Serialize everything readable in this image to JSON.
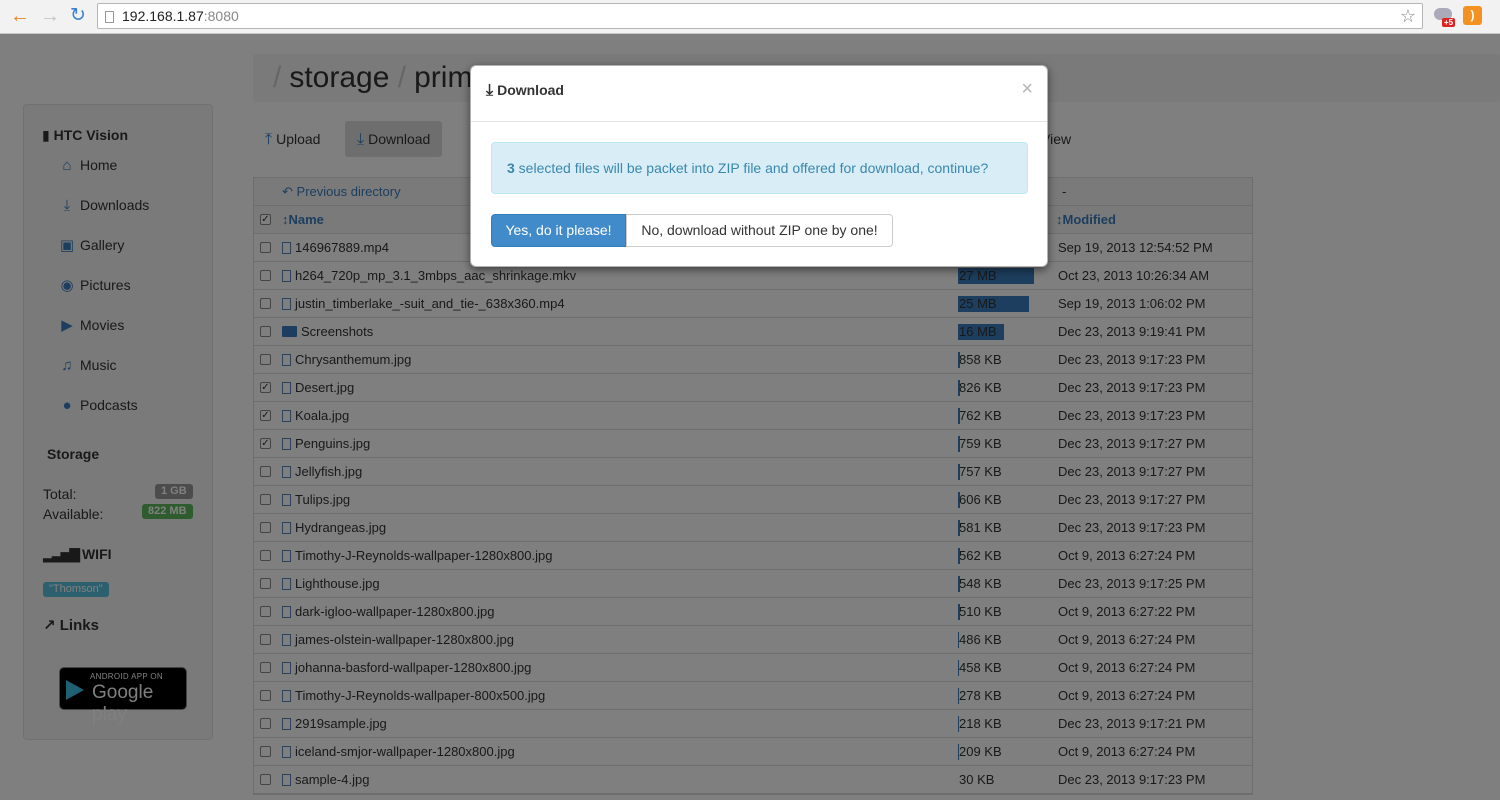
{
  "browser": {
    "url_host": "192.168.1.87",
    "url_port": ":8080",
    "ext_badge": "+5"
  },
  "breadcrumb": {
    "parts": [
      "storage",
      "prim"
    ]
  },
  "sidebar": {
    "device": "HTC Vision",
    "items": [
      {
        "label": "Home",
        "icon": "home-icon"
      },
      {
        "label": "Downloads",
        "icon": "download-icon"
      },
      {
        "label": "Gallery",
        "icon": "image-icon"
      },
      {
        "label": "Pictures",
        "icon": "camera-icon"
      },
      {
        "label": "Movies",
        "icon": "video-camera-icon"
      },
      {
        "label": "Music",
        "icon": "music-icon"
      },
      {
        "label": "Podcasts",
        "icon": "microphone-icon"
      }
    ],
    "storage_heading": "Storage",
    "total_label": "Total:",
    "total_value": "1 GB",
    "available_label": "Available:",
    "available_value": "822 MB",
    "wifi_heading": "WIFI",
    "wifi_name": "\"Thomson\"",
    "links_heading": "Links",
    "gplay_small": "ANDROID APP ON",
    "gplay_big": "Google play"
  },
  "toolbar": {
    "upload": "Upload",
    "download": "Download",
    "view_partial": "View"
  },
  "table": {
    "prev_dir": "Previous directory",
    "size_col_dash": "-",
    "col_name": "Name",
    "col_modified": "Modified",
    "rows": [
      {
        "name": "146967889.mp4",
        "type": "file",
        "checked": false,
        "size": "",
        "bar": 0,
        "modified": "Sep 19, 2013 12:54:52 PM"
      },
      {
        "name": "h264_720p_mp_3.1_3mbps_aac_shrinkage.mkv",
        "type": "file",
        "checked": false,
        "size": "27 MB",
        "bar": 76,
        "modified": "Oct 23, 2013 10:26:34 AM"
      },
      {
        "name": "justin_timberlake_-suit_and_tie-_638x360.mp4",
        "type": "file",
        "checked": false,
        "size": "25 MB",
        "bar": 71,
        "modified": "Sep 19, 2013 1:06:02 PM"
      },
      {
        "name": "Screenshots",
        "type": "folder",
        "checked": false,
        "size": "16 MB",
        "bar": 46,
        "modified": "Dec 23, 2013 9:19:41 PM"
      },
      {
        "name": "Chrysanthemum.jpg",
        "type": "file",
        "checked": false,
        "size": "858 KB",
        "bar": 2,
        "modified": "Dec 23, 2013 9:17:23 PM"
      },
      {
        "name": "Desert.jpg",
        "type": "file",
        "checked": true,
        "size": "826 KB",
        "bar": 2,
        "modified": "Dec 23, 2013 9:17:23 PM"
      },
      {
        "name": "Koala.jpg",
        "type": "file",
        "checked": true,
        "size": "762 KB",
        "bar": 2,
        "modified": "Dec 23, 2013 9:17:23 PM"
      },
      {
        "name": "Penguins.jpg",
        "type": "file",
        "checked": true,
        "size": "759 KB",
        "bar": 2,
        "modified": "Dec 23, 2013 9:17:27 PM"
      },
      {
        "name": "Jellyfish.jpg",
        "type": "file",
        "checked": false,
        "size": "757 KB",
        "bar": 2,
        "modified": "Dec 23, 2013 9:17:27 PM"
      },
      {
        "name": "Tulips.jpg",
        "type": "file",
        "checked": false,
        "size": "606 KB",
        "bar": 2,
        "modified": "Dec 23, 2013 9:17:27 PM"
      },
      {
        "name": "Hydrangeas.jpg",
        "type": "file",
        "checked": false,
        "size": "581 KB",
        "bar": 2,
        "modified": "Dec 23, 2013 9:17:23 PM"
      },
      {
        "name": "Timothy-J-Reynolds-wallpaper-1280x800.jpg",
        "type": "file",
        "checked": false,
        "size": "562 KB",
        "bar": 2,
        "modified": "Oct 9, 2013 6:27:24 PM"
      },
      {
        "name": "Lighthouse.jpg",
        "type": "file",
        "checked": false,
        "size": "548 KB",
        "bar": 2,
        "modified": "Dec 23, 2013 9:17:25 PM"
      },
      {
        "name": "dark-igloo-wallpaper-1280x800.jpg",
        "type": "file",
        "checked": false,
        "size": "510 KB",
        "bar": 2,
        "modified": "Oct 9, 2013 6:27:22 PM"
      },
      {
        "name": "james-olstein-wallpaper-1280x800.jpg",
        "type": "file",
        "checked": false,
        "size": "486 KB",
        "bar": 1,
        "modified": "Oct 9, 2013 6:27:24 PM"
      },
      {
        "name": "johanna-basford-wallpaper-1280x800.jpg",
        "type": "file",
        "checked": false,
        "size": "458 KB",
        "bar": 1,
        "modified": "Oct 9, 2013 6:27:24 PM"
      },
      {
        "name": "Timothy-J-Reynolds-wallpaper-800x500.jpg",
        "type": "file",
        "checked": false,
        "size": "278 KB",
        "bar": 1,
        "modified": "Oct 9, 2013 6:27:24 PM"
      },
      {
        "name": "2919sample.jpg",
        "type": "file",
        "checked": false,
        "size": "218 KB",
        "bar": 1,
        "modified": "Dec 23, 2013 9:17:21 PM"
      },
      {
        "name": "iceland-smjor-wallpaper-1280x800.jpg",
        "type": "file",
        "checked": false,
        "size": "209 KB",
        "bar": 1,
        "modified": "Oct 9, 2013 6:27:24 PM"
      },
      {
        "name": "sample-4.jpg",
        "type": "file",
        "checked": false,
        "size": "30 KB",
        "bar": 0,
        "modified": "Dec 23, 2013 9:17:23 PM"
      }
    ]
  },
  "modal": {
    "title": "Download",
    "close": "×",
    "count": "3",
    "message": " selected files will be packet into ZIP file and offered for download, continue?",
    "yes_label": "Yes, do it please!",
    "no_label": "No, download without ZIP one by one!"
  },
  "colors": {
    "accent": "#3b7dbd",
    "primary": "#428bca",
    "alert_bg": "#d9edf7"
  }
}
